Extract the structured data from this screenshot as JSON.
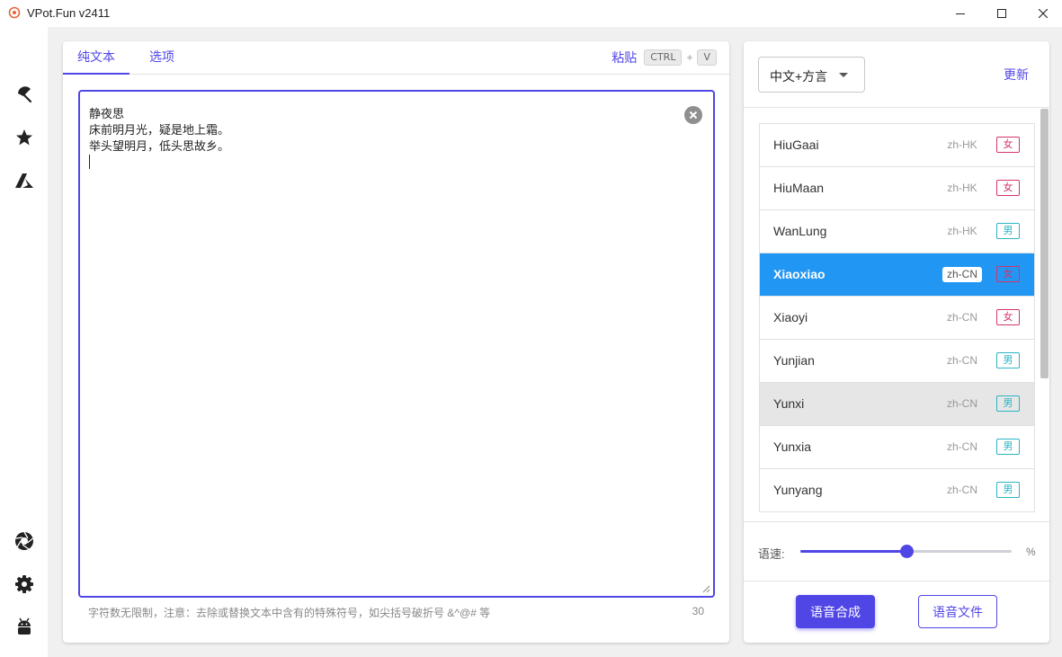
{
  "window": {
    "title": "VPot.Fun v2411"
  },
  "rail": {
    "icons": [
      "umbrella-icon",
      "star-icon",
      "azure-icon",
      "aperture-icon",
      "gear-icon",
      "android-icon"
    ]
  },
  "editor": {
    "tabs": [
      {
        "label": "纯文本",
        "active": true
      },
      {
        "label": "选项",
        "active": false
      }
    ],
    "paste": {
      "label": "粘贴",
      "key1": "CTRL",
      "plus": "+",
      "key2": "V"
    },
    "text_lines": [
      "静夜思",
      "床前明月光，疑是地上霜。",
      "举头望明月，低头思故乡。"
    ],
    "hint": "字符数无限制，注意：去除或替换文本中含有的特殊符号，如尖括号破折号 &^@# 等",
    "char_count": "30"
  },
  "voices": {
    "language_select": "中文+方言",
    "update_label": "更新",
    "items": [
      {
        "name": "HiuGaai",
        "lang": "zh-HK",
        "gender": "女"
      },
      {
        "name": "HiuMaan",
        "lang": "zh-HK",
        "gender": "女"
      },
      {
        "name": "WanLung",
        "lang": "zh-HK",
        "gender": "男"
      },
      {
        "name": "Xiaoxiao",
        "lang": "zh-CN",
        "gender": "女"
      },
      {
        "name": "Xiaoyi",
        "lang": "zh-CN",
        "gender": "女"
      },
      {
        "name": "Yunjian",
        "lang": "zh-CN",
        "gender": "男"
      },
      {
        "name": "Yunxi",
        "lang": "zh-CN",
        "gender": "男"
      },
      {
        "name": "Yunxia",
        "lang": "zh-CN",
        "gender": "男"
      },
      {
        "name": "Yunyang",
        "lang": "zh-CN",
        "gender": "男"
      }
    ],
    "selected_index": 3,
    "hovered_index": 6
  },
  "speed": {
    "label": "语速:",
    "value_fraction": 0.5,
    "unit": "%"
  },
  "actions": {
    "synthesize_label": "语音合成",
    "file_label": "语音文件"
  },
  "colors": {
    "accent": "#5046e5",
    "selected": "#2196f3",
    "female": "#d63369",
    "male": "#2bb4c4"
  }
}
